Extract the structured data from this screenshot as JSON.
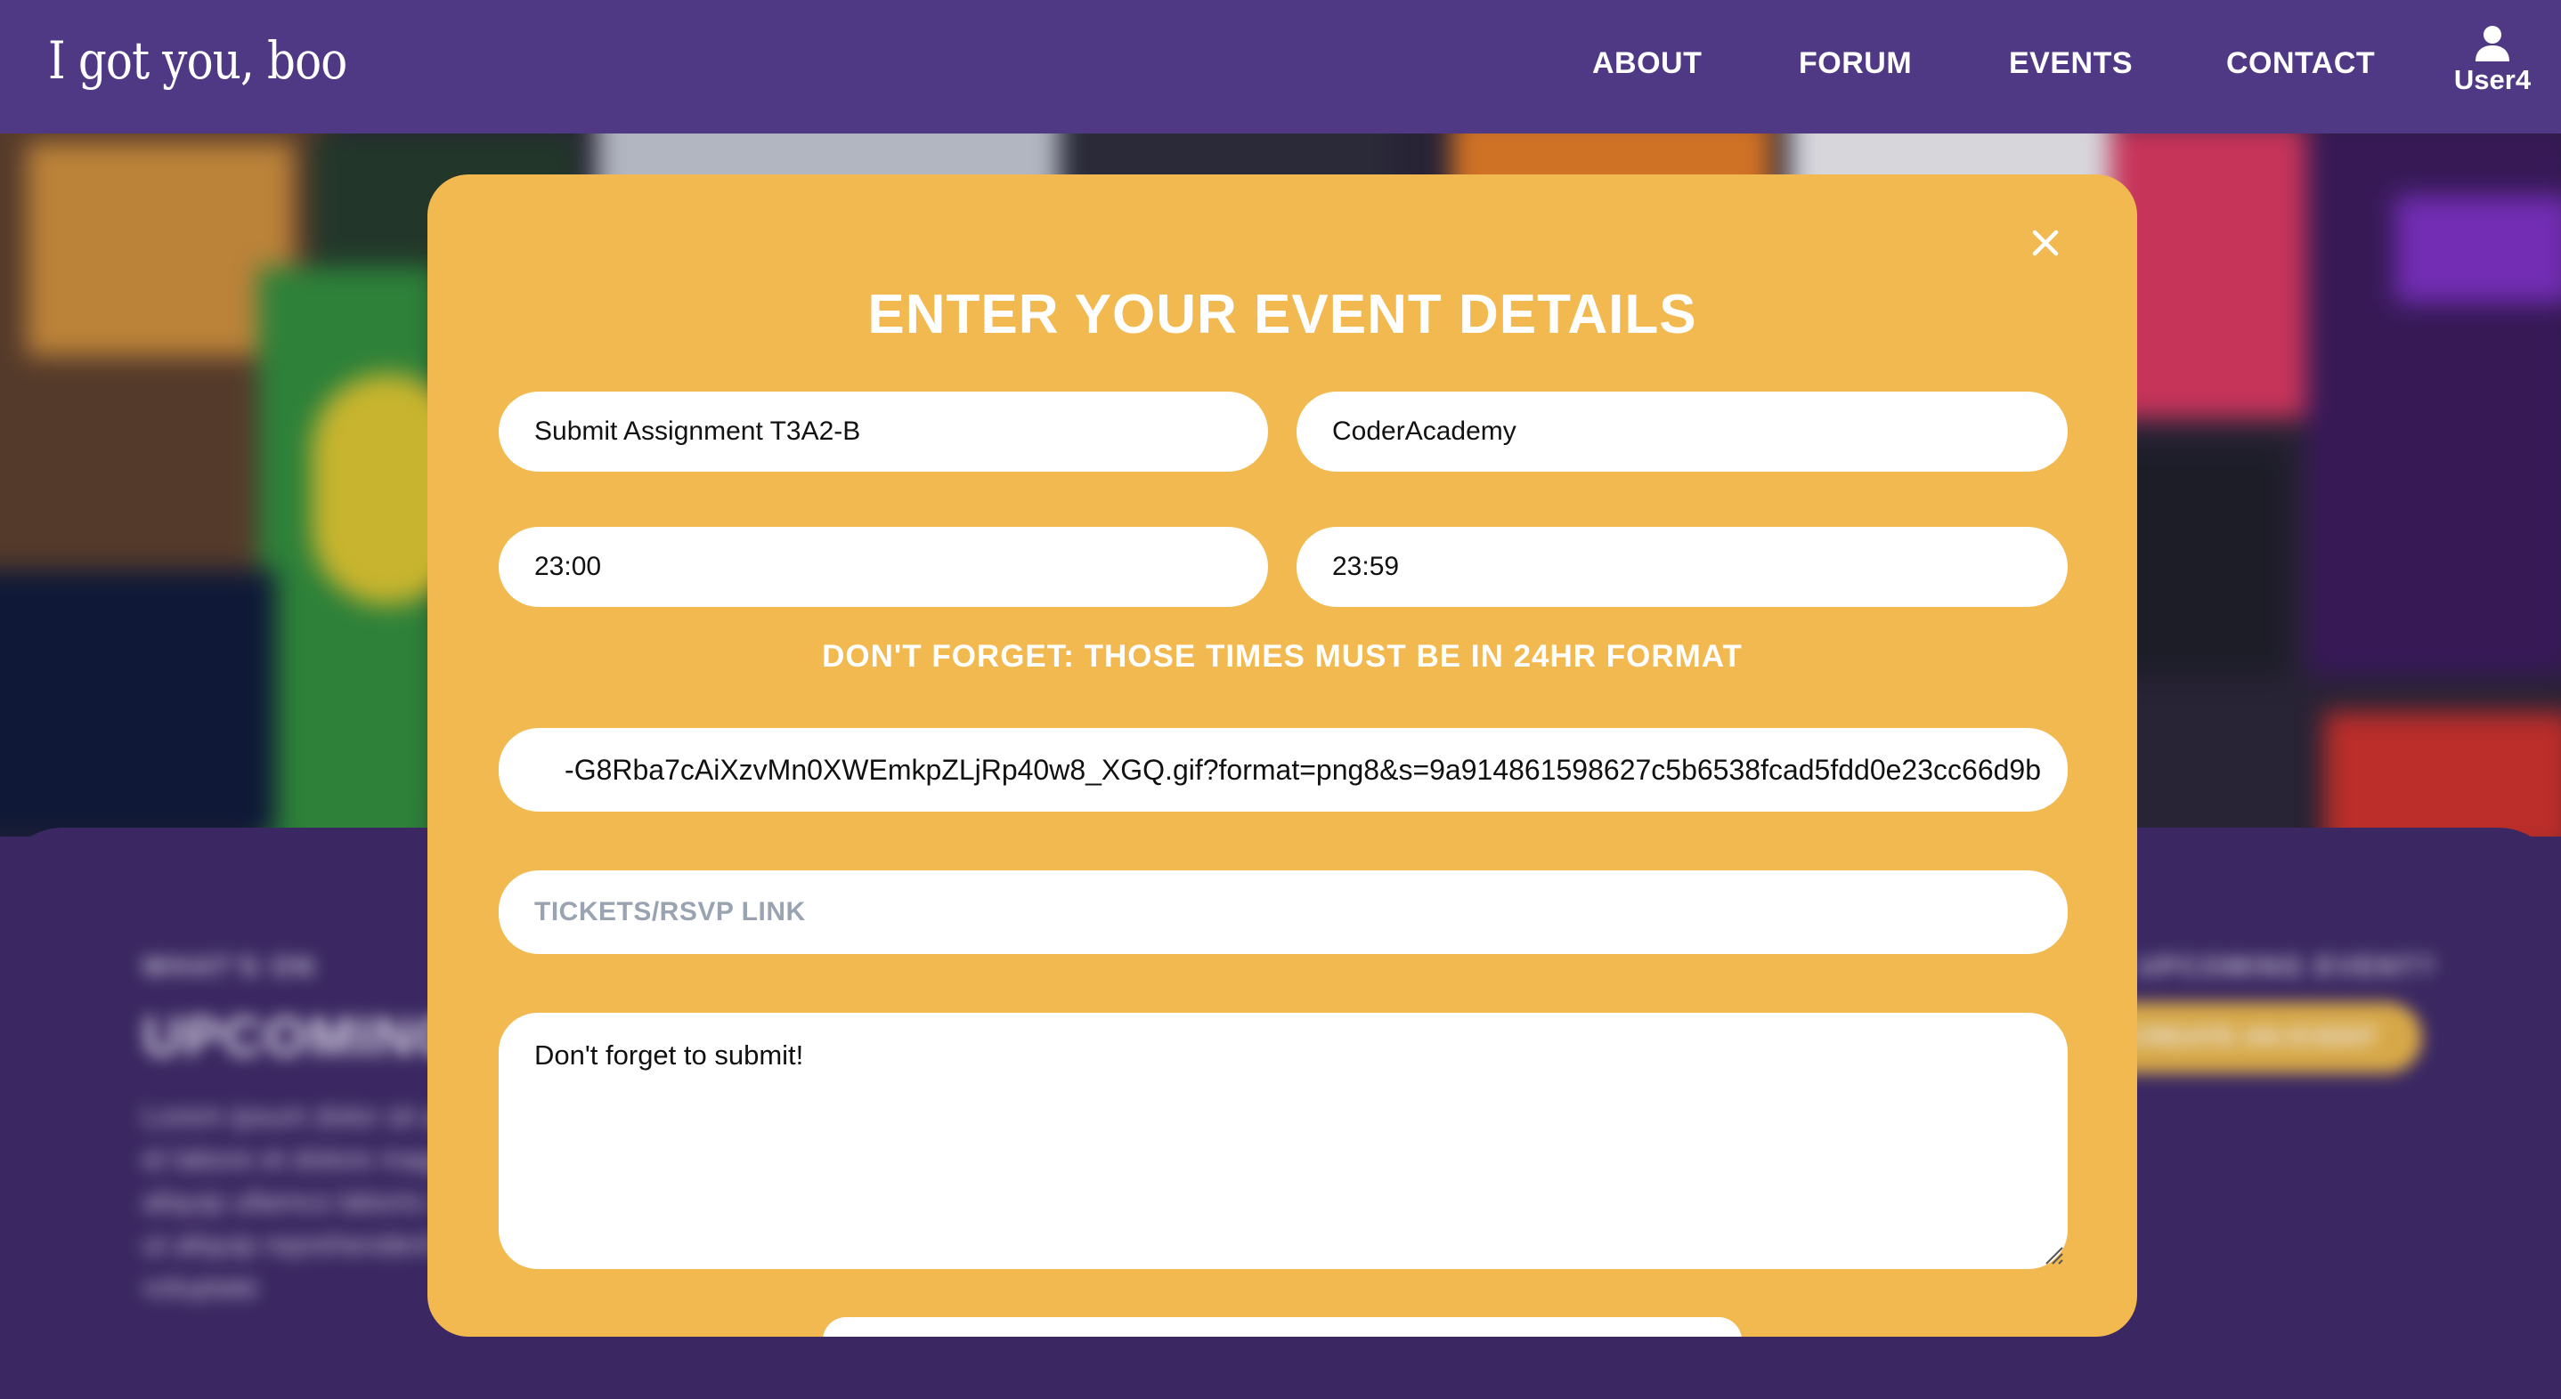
{
  "header": {
    "logo": "I got you, boo",
    "nav": [
      {
        "label": "ABOUT"
      },
      {
        "label": "FORUM"
      },
      {
        "label": "EVENTS"
      },
      {
        "label": "CONTACT"
      }
    ],
    "user": {
      "icon": "user-icon",
      "label": "User4"
    }
  },
  "background": {
    "section_kicker": "WHAT'S ON",
    "section_title": "UPCOMING",
    "section_text": "Lorem ipsum dolor sit amet, et labore et dolore magna aliquip ullamco laboris nisi ut aliquip reprehenderit in voluptate",
    "right_kicker": "UPCOMING EVENT?",
    "right_button": "CREATE AN EVENT"
  },
  "modal": {
    "title": "ENTER YOUR EVENT DETAILS",
    "close_icon": "close-icon",
    "fields": {
      "event_name": "Submit Assignment T3A2-B",
      "location": "CoderAcademy",
      "start_time": "23:00",
      "end_time": "23:59",
      "image_url": "-G8Rba7cAiXzvMn0XWEmkpZLjRp40w8_XGQ.gif?format=png8&s=9a914861598627c5b6538fcad5fdd0e23cc66d9b",
      "tickets_placeholder": "TICKETS/RSVP LINK",
      "description": "Don't forget to submit!"
    },
    "time_note": "DON'T FORGET: THOSE TIMES MUST BE IN 24HR FORMAT"
  },
  "colors": {
    "header": "#503984",
    "modal": "#f2b950",
    "background": "#3e2a66"
  }
}
